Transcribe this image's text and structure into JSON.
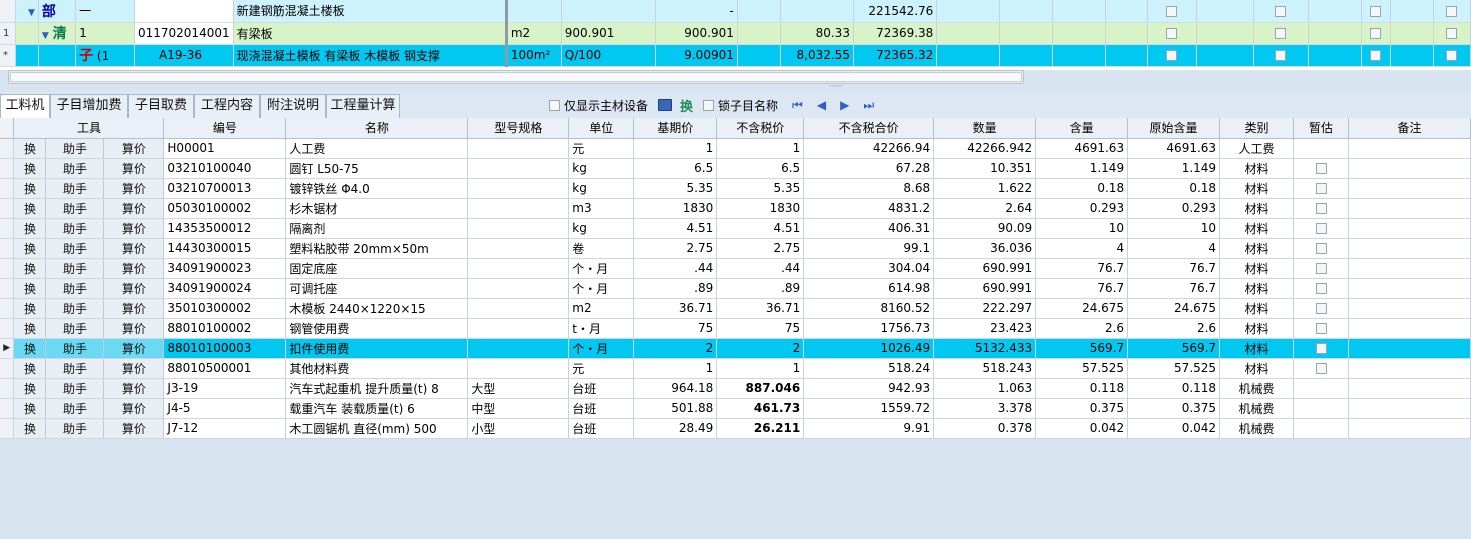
{
  "upper_grid": {
    "rows": [
      {
        "gutter": "",
        "tag": "部",
        "seq": "一",
        "code": "",
        "name": "新建钢筋混凝土楼板",
        "unit": "",
        "qty_expr": "",
        "qty": "-",
        "price": "",
        "total": "221542.76"
      },
      {
        "gutter": "1",
        "tag": "清",
        "seq": "1",
        "code": "011702014001",
        "name": "有梁板",
        "unit": "m2",
        "qty_expr": "900.901",
        "qty": "900.901",
        "price": "80.33",
        "total": "72369.38"
      },
      {
        "gutter": "*",
        "tag": "子",
        "seq": "(1",
        "code": "A19-36",
        "name": "现浇混凝土模板 有梁板 木模板 钢支撑",
        "unit": "100m²",
        "qty_expr": "Q/100",
        "qty": "9.00901",
        "price": "8,032.55",
        "total": "72365.32"
      }
    ]
  },
  "split_handle": "·····",
  "tabs": [
    "工料机",
    "子目增加费",
    "子目取费",
    "工程内容",
    "附注说明",
    "工程量计算"
  ],
  "toolbar": {
    "only_main_label": "仅显示主材设备",
    "huan_label": "换",
    "lock_label": "锁子目名称",
    "nav_first": "⏮",
    "nav_prev": "◀",
    "nav_next": "▶",
    "nav_last": "⏭"
  },
  "lower_grid": {
    "headers": [
      "工具",
      "编号",
      "名称",
      "型号规格",
      "单位",
      "基期价",
      "不含税价",
      "不含税合价",
      "数量",
      "含量",
      "原始含量",
      "类别",
      "暂估",
      "备注"
    ],
    "action_labels": [
      "换",
      "助手",
      "算价"
    ],
    "selected_indicator": "▶",
    "rows": [
      {
        "code": "H00001",
        "name": "人工费",
        "spec": "",
        "unit": "元",
        "base": "1",
        "price": "1",
        "amount": "42266.94",
        "qty": "42266.942",
        "content": "4691.63",
        "orig": "4691.63",
        "category": "人工费",
        "est": false
      },
      {
        "code": "03210100040",
        "name": "圆钉 L50-75",
        "spec": "",
        "unit": "kg",
        "base": "6.5",
        "price": "6.5",
        "amount": "67.28",
        "qty": "10.351",
        "content": "1.149",
        "orig": "1.149",
        "category": "材料",
        "est": true
      },
      {
        "code": "03210700013",
        "name": "镀锌铁丝 Φ4.0",
        "spec": "",
        "unit": "kg",
        "base": "5.35",
        "price": "5.35",
        "amount": "8.68",
        "qty": "1.622",
        "content": "0.18",
        "orig": "0.18",
        "category": "材料",
        "est": true
      },
      {
        "code": "05030100002",
        "name": "杉木锯材",
        "spec": "",
        "unit": "m3",
        "base": "1830",
        "price": "1830",
        "amount": "4831.2",
        "qty": "2.64",
        "content": "0.293",
        "orig": "0.293",
        "category": "材料",
        "est": true
      },
      {
        "code": "14353500012",
        "name": "隔离剂",
        "spec": "",
        "unit": "kg",
        "base": "4.51",
        "price": "4.51",
        "amount": "406.31",
        "qty": "90.09",
        "content": "10",
        "orig": "10",
        "category": "材料",
        "est": true
      },
      {
        "code": "14430300015",
        "name": "塑料粘胶带 20mm×50m",
        "spec": "",
        "unit": "卷",
        "base": "2.75",
        "price": "2.75",
        "amount": "99.1",
        "qty": "36.036",
        "content": "4",
        "orig": "4",
        "category": "材料",
        "est": true
      },
      {
        "code": "34091900023",
        "name": "固定底座",
        "spec": "",
        "unit": "个・月",
        "base": ".44",
        "price": ".44",
        "amount": "304.04",
        "qty": "690.991",
        "content": "76.7",
        "orig": "76.7",
        "category": "材料",
        "est": true
      },
      {
        "code": "34091900024",
        "name": "可调托座",
        "spec": "",
        "unit": "个・月",
        "base": ".89",
        "price": ".89",
        "amount": "614.98",
        "qty": "690.991",
        "content": "76.7",
        "orig": "76.7",
        "category": "材料",
        "est": true
      },
      {
        "code": "35010300002",
        "name": "木模板 2440×1220×15",
        "spec": "",
        "unit": "m2",
        "base": "36.71",
        "price": "36.71",
        "amount": "8160.52",
        "qty": "222.297",
        "content": "24.675",
        "orig": "24.675",
        "category": "材料",
        "est": true
      },
      {
        "code": "88010100002",
        "name": "钢管使用费",
        "spec": "",
        "unit": "t・月",
        "base": "75",
        "price": "75",
        "amount": "1756.73",
        "qty": "23.423",
        "content": "2.6",
        "orig": "2.6",
        "category": "材料",
        "est": true
      },
      {
        "code": "88010100003",
        "name": "扣件使用费",
        "spec": "",
        "unit": "个・月",
        "base": "2",
        "price": "2",
        "amount": "1026.49",
        "qty": "5132.433",
        "content": "569.7",
        "orig": "569.7",
        "category": "材料",
        "est": true,
        "selected": true
      },
      {
        "code": "88010500001",
        "name": "其他材料费",
        "spec": "",
        "unit": "元",
        "base": "1",
        "price": "1",
        "amount": "518.24",
        "qty": "518.243",
        "content": "57.525",
        "orig": "57.525",
        "category": "材料",
        "est": true
      },
      {
        "code": "J3-19",
        "name": "汽车式起重机 提升质量(t) 8",
        "spec": "大型",
        "unit": "台班",
        "base": "964.18",
        "price": "887.046",
        "amount": "942.93",
        "qty": "1.063",
        "content": "0.118",
        "orig": "0.118",
        "category": "机械费",
        "est": false,
        "bold_price": true
      },
      {
        "code": "J4-5",
        "name": "载重汽车 装载质量(t) 6",
        "spec": "中型",
        "unit": "台班",
        "base": "501.88",
        "price": "461.73",
        "amount": "1559.72",
        "qty": "3.378",
        "content": "0.375",
        "orig": "0.375",
        "category": "机械费",
        "est": false,
        "bold_price": true
      },
      {
        "code": "J7-12",
        "name": "木工圆锯机 直径(mm) 500",
        "spec": "小型",
        "unit": "台班",
        "base": "28.49",
        "price": "26.211",
        "amount": "9.91",
        "qty": "0.378",
        "content": "0.042",
        "orig": "0.042",
        "category": "机械费",
        "est": false,
        "bold_price": true
      }
    ]
  },
  "colors": {
    "selected_row": "#00c8f0",
    "bu_row": "#cdf2fb",
    "qing_row": "#d9f3c8",
    "background": "#d9e4f1"
  }
}
